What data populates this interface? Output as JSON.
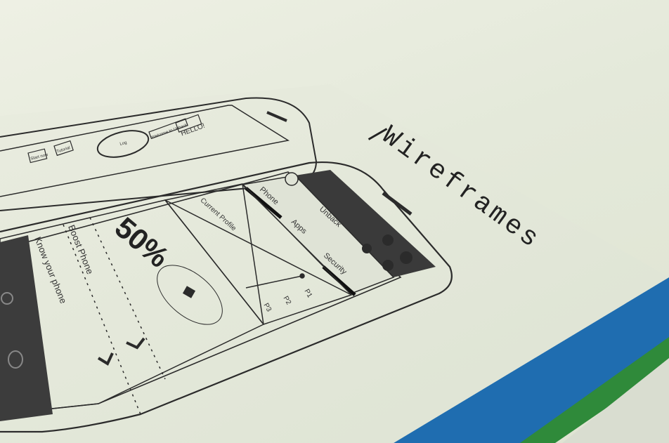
{
  "page": {
    "title": "Wireframes"
  },
  "phone_top": {
    "hello": "HELLO!",
    "welcome": "Welcome to Unback",
    "circle_label": "Log",
    "button1": "Tutorial",
    "button2": "Start now"
  },
  "phone_main": {
    "app_name": "Unback",
    "tabs": [
      "Phone",
      "Apps",
      "Security"
    ],
    "current_profile": "Current Profile",
    "profiles": [
      "P1",
      "P2",
      "P3"
    ]
  },
  "phone_left": {
    "percent": "50%",
    "boost": "Boost Phone",
    "know": "Know your phone"
  },
  "colors": {
    "paper": "#e3e8d8",
    "ink": "#2b2b2b",
    "cover_blue": "#1f6db0",
    "cover_green": "#2f8a3a"
  }
}
